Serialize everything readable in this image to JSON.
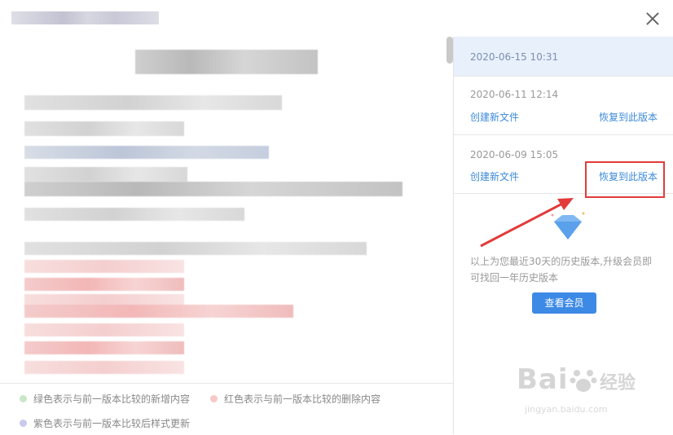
{
  "dialog": {
    "close_icon": "close-icon"
  },
  "versions": [
    {
      "date": "2020-06-15 10:31",
      "active": true
    },
    {
      "date": "2020-06-11 12:14",
      "create_label": "创建新文件",
      "restore_label": "恢复到此版本"
    },
    {
      "date": "2020-06-09 15:05",
      "create_label": "创建新文件",
      "restore_label": "恢复到此版本"
    }
  ],
  "history_note": "以上为您最近30天的历史版本,升级会员即可找回一年历史版本",
  "vip_button": "查看会员",
  "legend": {
    "green": {
      "label": "绿色表示与前一版本比较的新增内容",
      "color": "#c9e7c9"
    },
    "red": {
      "label": "红色表示与前一版本比较的删除内容",
      "color": "#f7c8c8"
    },
    "purple": {
      "label": "紫色表示与前一版本比较后样式更新",
      "color": "#c9c9ee"
    }
  },
  "watermark": {
    "brand": "Bai",
    "brand_cn": "经验",
    "url": "jingyan.baidu.com"
  },
  "colors": {
    "accent": "#3d8ae6",
    "link": "#3d8ad8",
    "highlight": "#e33b3b"
  }
}
